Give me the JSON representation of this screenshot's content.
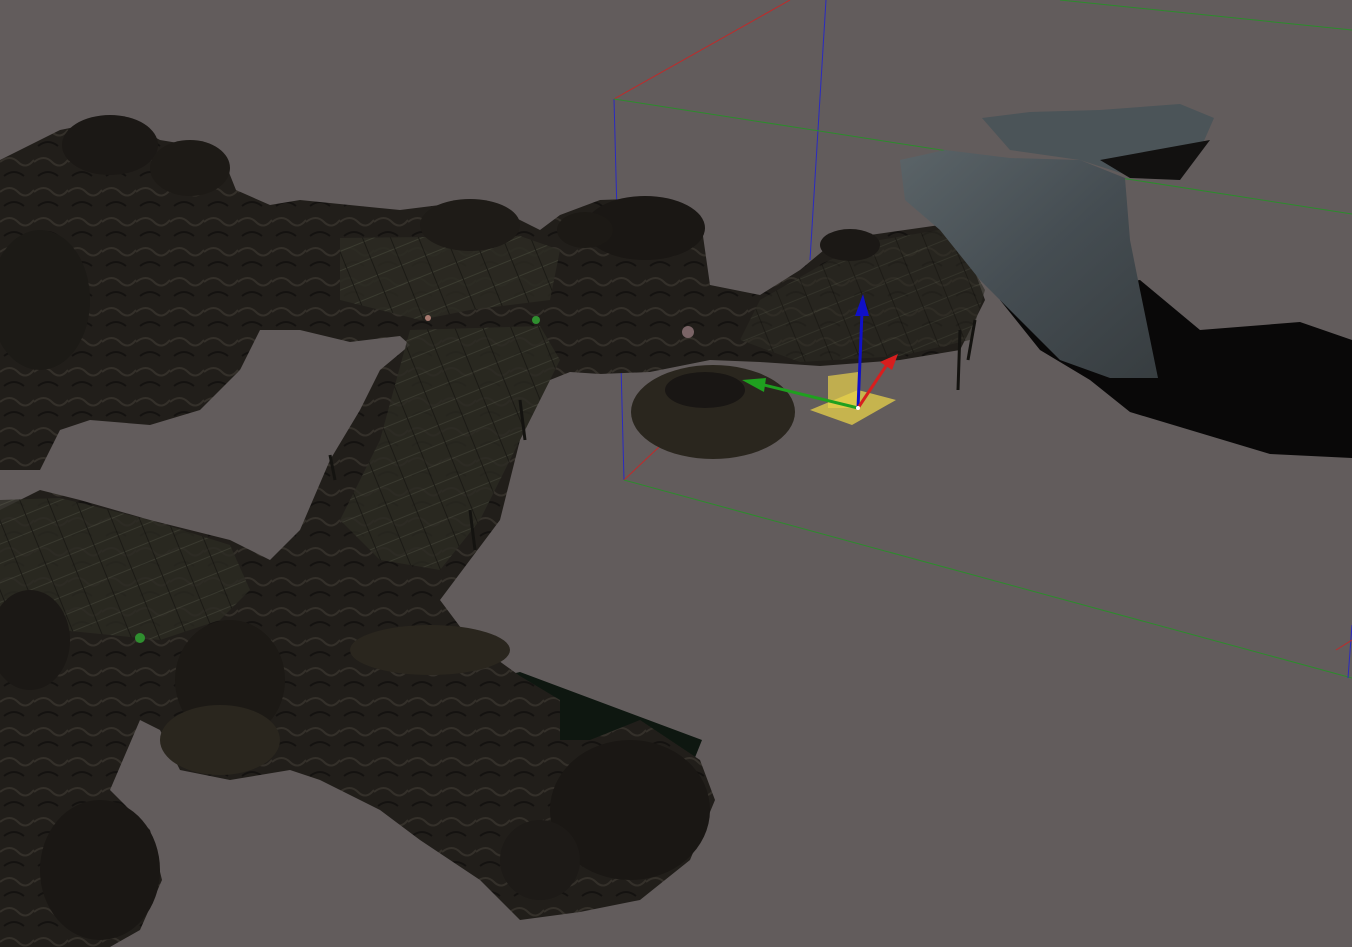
{
  "viewport": {
    "background_color": "#625c5c",
    "view_mode": "perspective",
    "selection_active": true
  },
  "gizmo": {
    "type": "translate",
    "axes": [
      {
        "axis": "x",
        "color": "#d81e1e",
        "icon": "arrow-right-icon"
      },
      {
        "axis": "y",
        "color": "#1fa01f",
        "icon": "arrow-left-icon"
      },
      {
        "axis": "z",
        "color": "#1010c8",
        "icon": "arrow-up-icon"
      }
    ],
    "plane_handle_color": "#e8d24a"
  },
  "bounding_box": {
    "x_color": "#c02a2a",
    "y_color": "#2c8c2c",
    "z_color": "#2a2ac0"
  },
  "scene": {
    "terrain_color": "#2a261e",
    "rock_color": "#1f1c18",
    "cliff_color": "#4a5256",
    "shadow_color": "#090808",
    "water_color": "#0e1710"
  }
}
